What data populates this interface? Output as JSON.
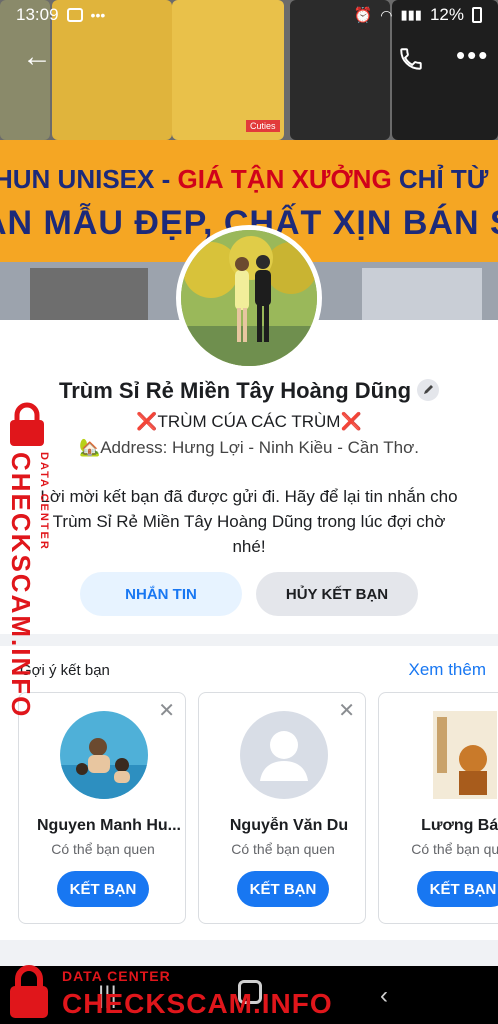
{
  "status_bar": {
    "time": "13:09",
    "battery": "12%"
  },
  "cover": {
    "banner_line1_a": "HUN UNISEX - ",
    "banner_line1_b": "GIÁ TẬN XƯỞNG",
    "banner_line1_c": " CHỈ TỪ",
    "banner_line2": "AN MẪU ĐẸP, CHẤT XỊN BÁN SỈ",
    "tag": "Cuties"
  },
  "profile": {
    "name": "Trùm Sỉ Rẻ Miền Tây Hoàng Dũng",
    "subtitle_mark": "❌",
    "subtitle": "TRÙM CÚA CÁC TRÙM",
    "address_icon": "🏡",
    "address": "Address: Hưng Lợi - Ninh Kiều - Cần Thơ.",
    "notice": "Lời mời kết bạn đã được gửi đi. Hãy để lại tin nhắn cho Trùm Sỉ Rẻ Miền Tây Hoàng Dũng trong lúc đợi chờ nhé!",
    "message_button": "NHẮN TIN",
    "cancel_button": "HỦY KẾT BẠN"
  },
  "suggestions": {
    "title": "Gợi ý kết bạn",
    "see_more": "Xem thêm",
    "cards": [
      {
        "name": "Nguyen Manh Hu...",
        "sub": "Có thể bạn quen",
        "button": "KẾT BẠN"
      },
      {
        "name": "Nguyễn Văn Du",
        "sub": "Có thể bạn quen",
        "button": "KẾT BẠN"
      },
      {
        "name": "Lương Bá Li",
        "sub": "Có thể bạn quen",
        "button": "KẾT BẠN"
      }
    ]
  },
  "watermark": {
    "small": "DATA CENTER",
    "main": "CHECKSCAM.INFO"
  },
  "colors": {
    "accent": "#1877f2",
    "watermark": "#e0161b",
    "banner": "#f5a623"
  }
}
